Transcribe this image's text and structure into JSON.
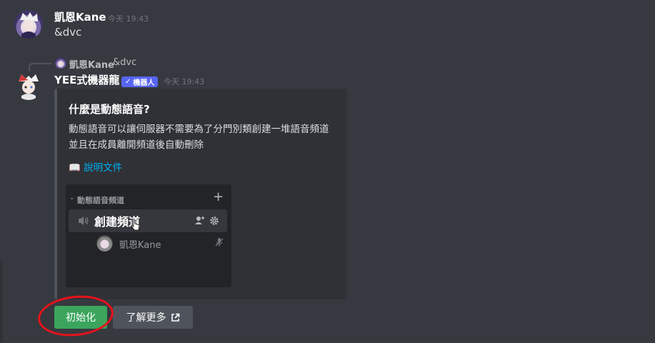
{
  "colors": {
    "background": "#36393f",
    "embed_bg": "#2f3136",
    "embed_border": "#4f545c",
    "link": "#00aff4",
    "bot_badge": "#5865f2",
    "primary_button": "#3ba55d",
    "secondary_button": "#4f545c",
    "annotation": "#e8121b"
  },
  "message1": {
    "author": "凱恩Kane",
    "timestamp": "今天 19:43",
    "text": "&dvc"
  },
  "reply": {
    "author": "凱恩Kane",
    "text": "&dvc"
  },
  "message2": {
    "author": "YEE式機器龍",
    "badge": "機器人",
    "timestamp": "今天 19:43",
    "embed": {
      "title": "什麼是動態語音?",
      "description": "動態語音可以讓伺服器不需要為了分門別類創建一堆語音頻道\n並且在成員離開頻道後自動刪除",
      "link_icon": "📖",
      "link_text": "說明文件",
      "preview": {
        "category": "動態語音頻道",
        "channel": "創建頻道",
        "user": "凱恩Kane"
      }
    },
    "buttons": {
      "init": "初始化",
      "learn_more": "了解更多"
    }
  }
}
